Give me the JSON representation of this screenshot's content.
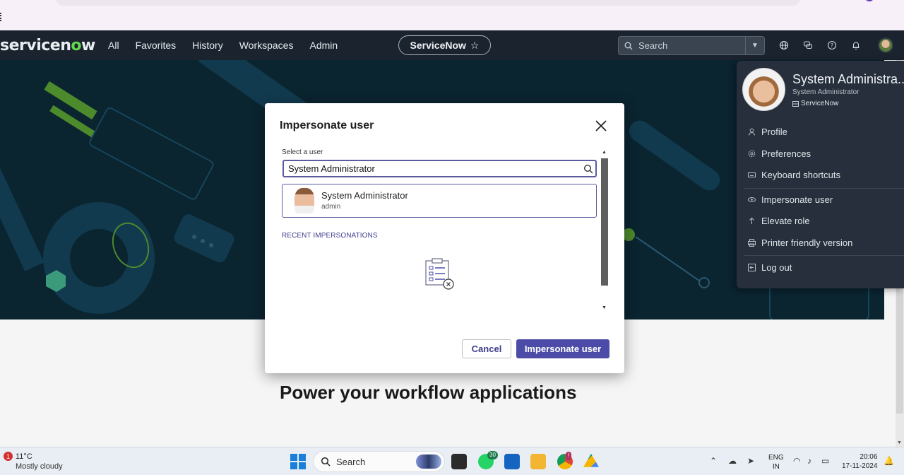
{
  "app": {
    "brand_prefix": "servicen",
    "brand_o": "o",
    "brand_suffix": "w",
    "nav": [
      "All",
      "Favorites",
      "History",
      "Workspaces",
      "Admin"
    ],
    "instance_name": "ServiceNow",
    "instance_star": "☆",
    "search_placeholder": "Search",
    "accent": "#62d84e"
  },
  "modal": {
    "title": "Impersonate user",
    "field_label": "Select a user",
    "input_value": "System Administrator",
    "result": {
      "name": "System Administrator",
      "username": "admin"
    },
    "recent_label": "RECENT IMPERSONATIONS",
    "cancel_label": "Cancel",
    "confirm_label": "Impersonate user",
    "primary_color": "#4c4ca8"
  },
  "user_menu": {
    "name": "System Administra...",
    "role": "System Administrator",
    "org": "ServiceNow",
    "items": [
      {
        "label": "Profile",
        "icon": "person-icon"
      },
      {
        "label": "Preferences",
        "icon": "gear-icon"
      },
      {
        "label": "Keyboard shortcuts",
        "icon": "keyboard-icon"
      },
      {
        "label": "Impersonate user",
        "icon": "eye-icon"
      },
      {
        "label": "Elevate role",
        "icon": "arrow-up-icon"
      },
      {
        "label": "Printer friendly version",
        "icon": "printer-icon"
      },
      {
        "label": "Log out",
        "icon": "logout-icon"
      }
    ]
  },
  "page": {
    "headline": "Power your workflow applications"
  },
  "taskbar": {
    "weather_alert_count": "1",
    "temperature": "11°C",
    "weather": "Mostly cloudy",
    "search_label": "Search",
    "whatsapp_badge": "30",
    "chrome_badge": "!",
    "lang_line1": "ENG",
    "lang_line2": "IN",
    "time": "20:06",
    "date": "17-11-2024"
  }
}
